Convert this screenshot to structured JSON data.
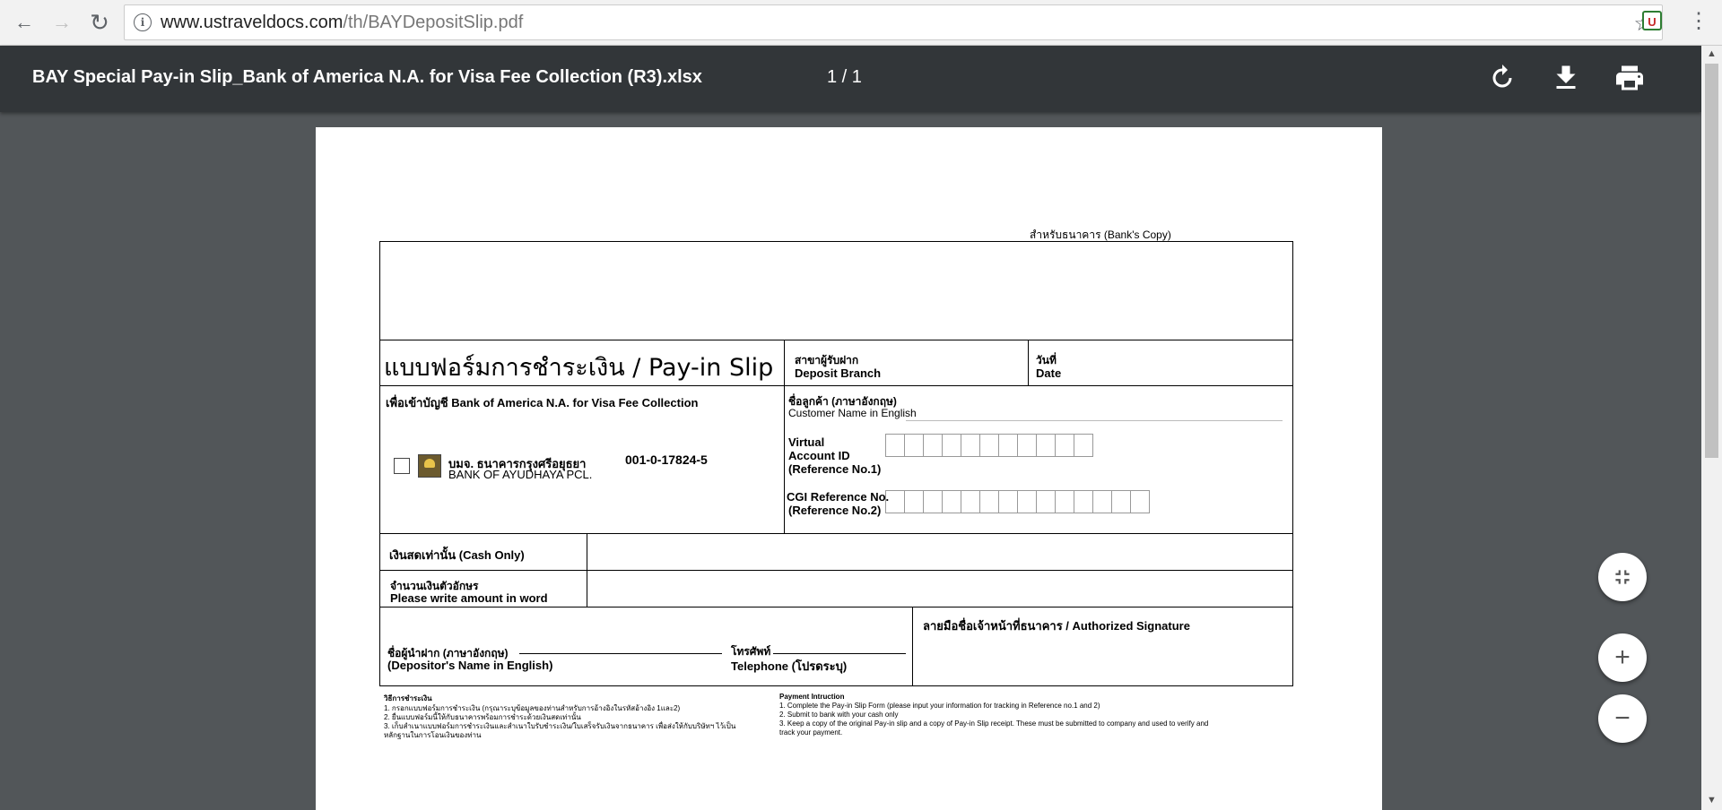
{
  "browser": {
    "back_icon": "←",
    "forward_icon": "→",
    "reload_icon": "↻",
    "url_host": "www.ustraveldocs.com",
    "url_path": "/th/BAYDepositSlip.pdf",
    "star_icon": "☆",
    "menu_icon": "⋮"
  },
  "viewer": {
    "title": "BAY Special Pay-in Slip_Bank of America N.A. for Visa Fee Collection (R3).xlsx",
    "page_indicator": "1  /  1"
  },
  "slip": {
    "copy_label": "สำหรับธนาคาร (Bank's Copy)",
    "form_title": "แบบฟอร์มการชำระเงิน / Pay-in Slip",
    "branch_th": "สาขาผู้รับฝาก",
    "branch_en": "Deposit Branch",
    "date_th": "วันที่",
    "date_en": "Date",
    "account_label": "เพื่อเข้าบัญชี  Bank of America N.A. for Visa Fee Collection",
    "bank_th": "บมจ. ธนาคารกรุงศรีอยุธยา",
    "bank_en": "BANK OF AYUDHAYA PCL.",
    "account_no": "001-0-17824-5",
    "customer_th": "ชื่อลูกค้า (ภาษาอังกฤษ)",
    "customer_en": "Customer Name  in English",
    "virtual_1": "Virtual",
    "virtual_2": "Account ID",
    "virtual_3": "(Reference No.1)",
    "cgi_1": "CGI Reference No.",
    "cgi_2": "(Reference No.2)",
    "cash_only": "เงินสดเท่านั้น (Cash Only)",
    "amount_word_th": "จำนวนเงินตัวอักษร",
    "amount_word_en": "Please write amount in word",
    "signature": "ลายมือชื่อเจ้าหน้าที่ธนาคาร / Authorized Signature",
    "depositor_th": "ชื่อผู้นำฝาก (ภาษาอังกฤษ)",
    "depositor_en": "(Depositor's Name in English)",
    "phone_th": "โทรศัพท์",
    "phone_en": "Telephone  (โปรดระบุ)",
    "th_instr_title": "วิธีการชำระเงิน",
    "th_instr_1": "1. กรอกแบบฟอร์มการชำระเงิน (กรุณาระบุข้อมูลของท่านสำหรับการอ้างอิงในรหัสอ้างอิง 1และ2)",
    "th_instr_2": "2. ยื่นแบบฟอร์มนี้ให้กับธนาคารพร้อมการชำระด้วยเงินสดเท่านั้น",
    "th_instr_3": "3. เก็บสำเนาแบบฟอร์มการชำระเงินและสำเนาใบรับชำระเงิน/ใบเสร็จรับเงินจากธนาคาร เพื่อส่งให้กับบริษัทฯ ไว้เป็น",
    "th_instr_4": "หลักฐานในการโอนเงินของท่าน",
    "en_instr_title": "Payment Intruction",
    "en_instr_1": "1. Complete the Pay-in Slip Form (please input your information for tracking in Reference no.1 and 2)",
    "en_instr_2": "2. Submit to bank with your cash only",
    "en_instr_3": "3. Keep a copy of the original Pay-in slip and a copy of Pay-in Slip receipt. These must be submitted to company and used to verify and",
    "en_instr_4": "track your payment."
  },
  "controls": {
    "fit_icon": "⤢",
    "zoom_in_icon": "+",
    "zoom_out_icon": "−"
  }
}
